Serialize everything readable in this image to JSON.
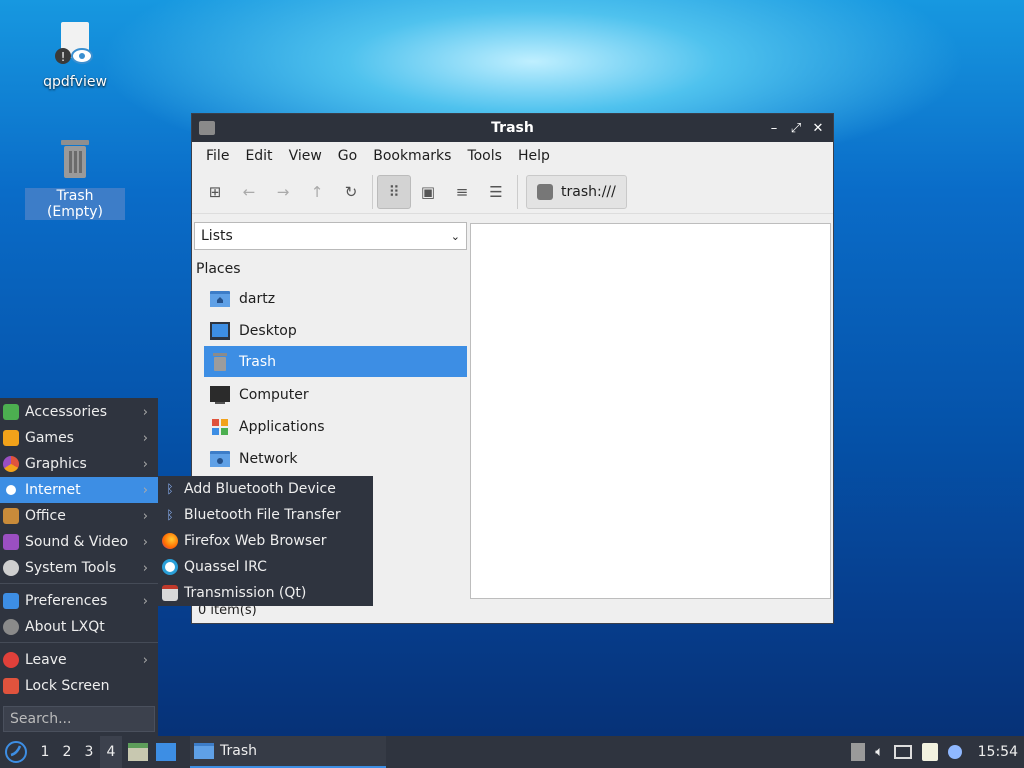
{
  "desktop": {
    "icons": [
      {
        "label": "qpdfview"
      },
      {
        "label": "Trash (Empty)"
      }
    ]
  },
  "window": {
    "title": "Trash",
    "controls": {
      "minimize": "–",
      "maximize": "⤢",
      "close": "✕"
    },
    "menu": [
      "File",
      "Edit",
      "View",
      "Go",
      "Bookmarks",
      "Tools",
      "Help"
    ],
    "path": "trash:///",
    "side_pane_mode": "Lists",
    "places_header": "Places",
    "places": [
      {
        "label": "dartz",
        "icon": "home-folder-icon"
      },
      {
        "label": "Desktop",
        "icon": "desktop-icon"
      },
      {
        "label": "Trash",
        "icon": "trash-icon",
        "selected": true
      },
      {
        "label": "Computer",
        "icon": "computer-icon"
      },
      {
        "label": "Applications",
        "icon": "applications-icon"
      },
      {
        "label": "Network",
        "icon": "network-folder-icon"
      }
    ],
    "status": "0 item(s)"
  },
  "start_menu": {
    "items": [
      {
        "label": "Accessories",
        "color": "#4caf50"
      },
      {
        "label": "Games",
        "color": "#f2a21a"
      },
      {
        "label": "Graphics",
        "color": "#e0533d"
      },
      {
        "label": "Internet",
        "color": "#3d8ee4"
      },
      {
        "label": "Office",
        "color": "#c98b3a"
      },
      {
        "label": "Sound & Video",
        "color": "#9b4fc2"
      },
      {
        "label": "System Tools",
        "color": "#cfcfcf"
      },
      {
        "label": "Preferences",
        "color": "#3d8ee4"
      },
      {
        "label": "About LXQt",
        "color": "#8a8a8a"
      },
      {
        "label": "Leave",
        "color": "#e0403a"
      },
      {
        "label": "Lock Screen",
        "color": "#e0533d"
      }
    ],
    "search_placeholder": "Search...",
    "submenu": [
      {
        "label": "Add Bluetooth Device"
      },
      {
        "label": "Bluetooth File Transfer"
      },
      {
        "label": "Firefox Web Browser"
      },
      {
        "label": "Quassel IRC"
      },
      {
        "label": "Transmission (Qt)"
      }
    ]
  },
  "taskbar": {
    "desktops": [
      "1",
      "2",
      "3",
      "4"
    ],
    "task_title": "Trash",
    "clock": "15:54"
  }
}
